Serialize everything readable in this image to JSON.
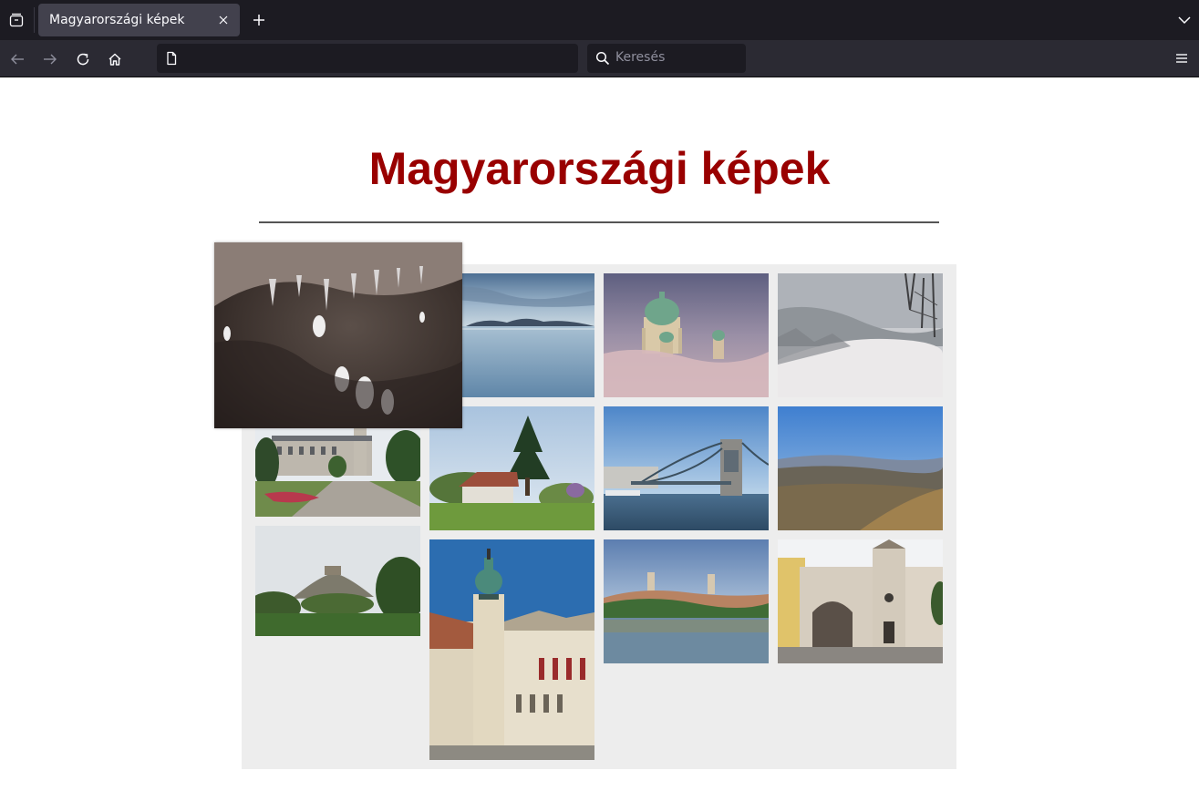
{
  "browser": {
    "tab_title": "Magyarországi képek",
    "search_placeholder": "Keresés",
    "url": ""
  },
  "page": {
    "title": "Magyarországi képek",
    "title_color": "#990000",
    "gallery_background": "#ededed"
  },
  "gallery": {
    "images": [
      {
        "name": "cave-stalactites-photo",
        "state": "enlarged"
      },
      {
        "name": "balaton-lake-photo"
      },
      {
        "name": "esztergom-basilica-fog-photo"
      },
      {
        "name": "snowy-forest-photo"
      },
      {
        "name": "festetics-palace-photo"
      },
      {
        "name": "farmhouse-pine-photo"
      },
      {
        "name": "chain-bridge-photo"
      },
      {
        "name": "hills-landscape-photo"
      },
      {
        "name": "castle-hill-photo"
      },
      {
        "name": "fire-tower-sopron-photo"
      },
      {
        "name": "danube-town-photo"
      },
      {
        "name": "castle-gate-photo"
      }
    ]
  },
  "icons": {
    "tab_overview": "tab-overview-icon",
    "close_tab": "close-icon",
    "new_tab": "plus-icon",
    "list_all_tabs": "chevron-down-icon",
    "back": "arrow-left-icon",
    "forward": "arrow-right-icon",
    "reload": "reload-icon",
    "home": "home-icon",
    "page": "page-icon",
    "search": "search-icon",
    "menu": "hamburger-menu-icon"
  }
}
